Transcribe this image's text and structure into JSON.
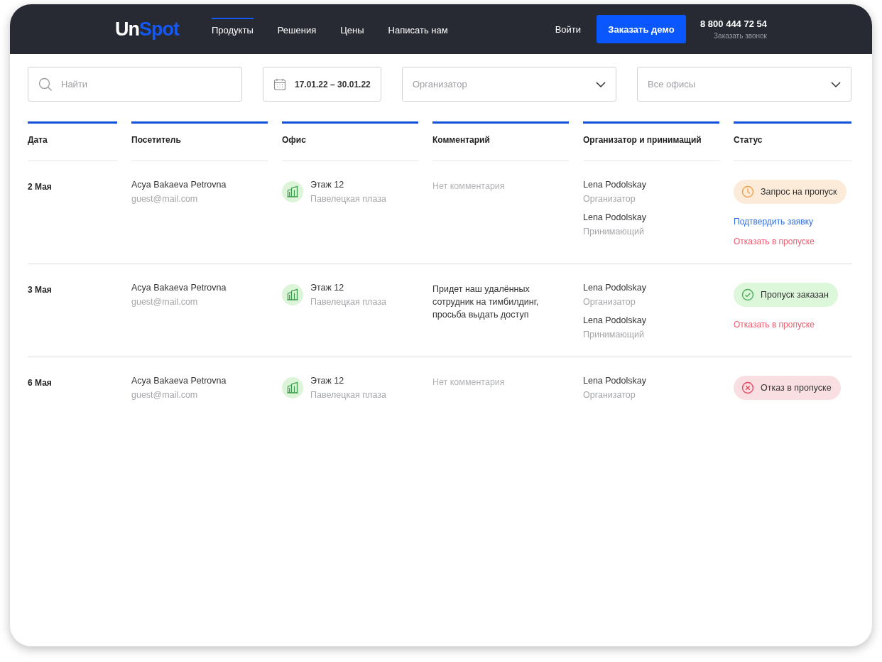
{
  "header": {
    "logo": {
      "part_1": "Un",
      "part_2": "Spot"
    },
    "nav": [
      {
        "label": "Продукты",
        "selected": true
      },
      {
        "label": "Решения",
        "selected": false
      },
      {
        "label": "Цены",
        "selected": false
      },
      {
        "label": "Написать нам",
        "selected": false
      }
    ],
    "login": "Войти",
    "demo_button": "Заказать демо",
    "phone": "8 800 444 72 54",
    "callback": "Заказать звонок"
  },
  "filters": {
    "search": {
      "placeholder": "Найти"
    },
    "date_range": {
      "value": "17.01.22 – 30.01.22"
    },
    "organizer": {
      "placeholder": "Организатор"
    },
    "offices": {
      "placeholder": "Все офисы"
    }
  },
  "table": {
    "columns": [
      "Дата",
      "Посетитель",
      "Офис",
      "Комментарий",
      "Организатор и принимащий",
      "Статус"
    ],
    "rows": [
      {
        "date": "2 Мая",
        "visitor": {
          "name": "Acya Bakaeva Petrovna",
          "email": "guest@mail.com"
        },
        "office": {
          "floor": "Этаж 12",
          "building": "Павелецкая плаза"
        },
        "comment": {
          "text": "Нет комментария",
          "empty": true
        },
        "people": [
          {
            "name": "Lena Podolskay",
            "role": "Организатор"
          },
          {
            "name": "Lena Podolskay",
            "role": "Принимающий"
          }
        ],
        "status": {
          "kind": "request",
          "label": "Запрос на пропуск"
        },
        "actions": [
          {
            "kind": "confirm",
            "label": "Подтвердить заявку"
          },
          {
            "kind": "refuse",
            "label": "Отказать в пропуске"
          }
        ]
      },
      {
        "date": "3 Мая",
        "visitor": {
          "name": "Acya Bakaeva Petrovna",
          "email": "guest@mail.com"
        },
        "office": {
          "floor": "Этаж 12",
          "building": "Павелецкая плаза"
        },
        "comment": {
          "text": "Придет наш удалённых сотрудник на тимбилдинг, просьба выдать доступ",
          "empty": false
        },
        "people": [
          {
            "name": "Lena Podolskay",
            "role": "Организатор"
          },
          {
            "name": "Lena Podolskay",
            "role": "Принимающий"
          }
        ],
        "status": {
          "kind": "ordered",
          "label": "Пропуск заказан"
        },
        "actions": [
          {
            "kind": "refuse",
            "label": "Отказать в пропуске"
          }
        ]
      },
      {
        "date": "6 Мая",
        "visitor": {
          "name": "Acya Bakaeva Petrovna",
          "email": "guest@mail.com"
        },
        "office": {
          "floor": "Этаж 12",
          "building": "Павелецкая плаза"
        },
        "comment": {
          "text": "Нет комментария",
          "empty": true
        },
        "people": [
          {
            "name": "Lena Podolskay",
            "role": "Организатор"
          }
        ],
        "status": {
          "kind": "refused",
          "label": "Отказ в пропуске"
        },
        "actions": []
      }
    ]
  }
}
